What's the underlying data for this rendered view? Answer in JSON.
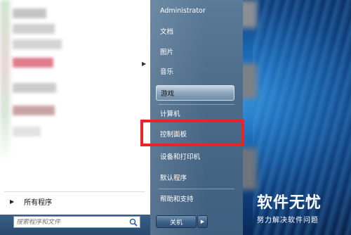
{
  "right_panel": {
    "items": [
      {
        "label": "Administrator"
      },
      {
        "label": "文档"
      },
      {
        "label": "图片"
      },
      {
        "label": "音乐"
      },
      {
        "label": "游戏"
      },
      {
        "label": "计算机"
      },
      {
        "label": "控制面板"
      },
      {
        "label": "设备和打印机"
      },
      {
        "label": "默认程序"
      },
      {
        "label": "帮助和支持"
      }
    ],
    "highlighted_item": "游戏",
    "shutdown_label": "关机",
    "shutdown_arrow": "▶"
  },
  "left_panel": {
    "all_programs_label": "所有程序",
    "all_programs_arrow": "▶",
    "submenu_arrow": "▶"
  },
  "search": {
    "placeholder": "搜索程序和文件",
    "icon": "search-icon"
  },
  "annotation": {
    "target": "控制面板",
    "color": "#e8232a"
  },
  "watermark": {
    "logo": "软件无忧",
    "subtitle": "努力解决软件问题"
  }
}
